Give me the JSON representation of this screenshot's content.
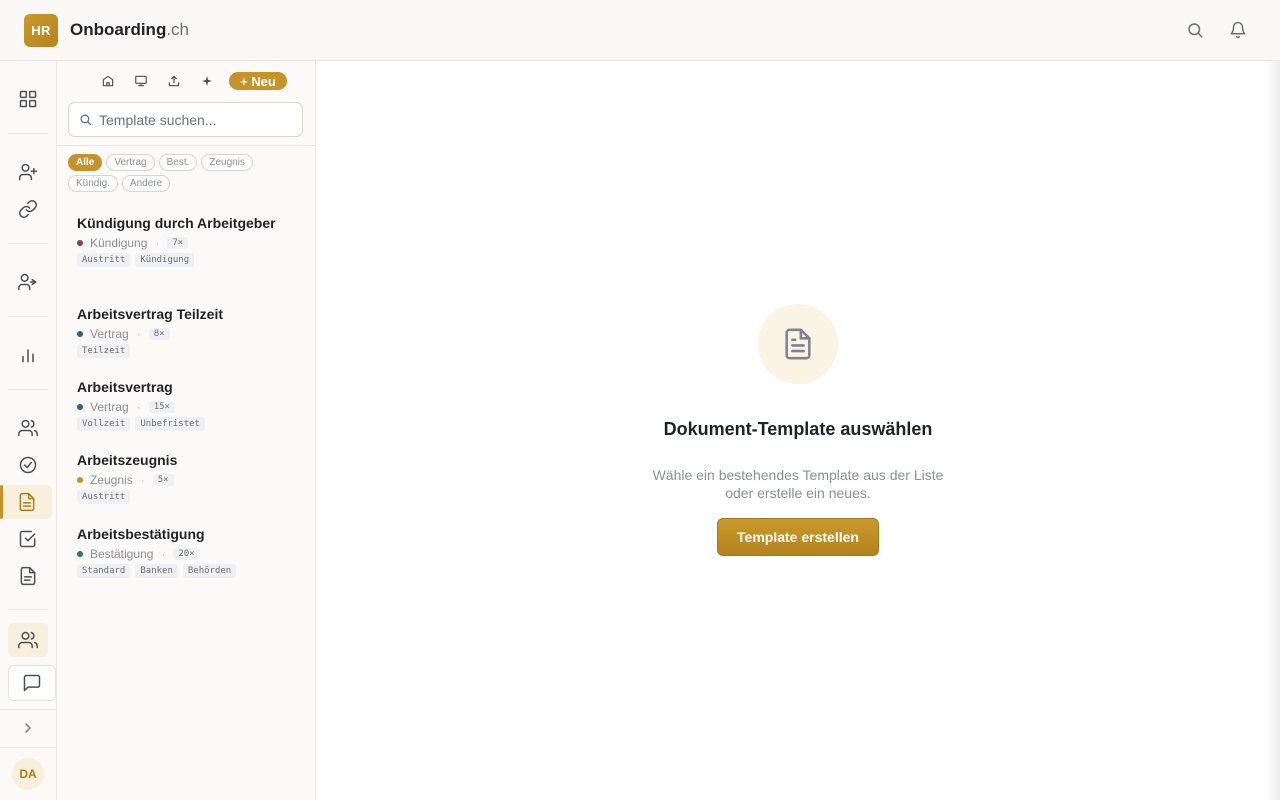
{
  "header": {
    "logo_text": "HR",
    "brand_name": "Onboarding",
    "brand_suffix": ".ch",
    "icons": [
      "search-icon",
      "bell-icon"
    ]
  },
  "rail": {
    "items": [
      {
        "icon": "grid-icon"
      },
      {
        "icon": "user-plus-icon"
      },
      {
        "icon": "link-icon"
      },
      {
        "icon": "user-arrow-icon"
      },
      {
        "icon": "bar-chart-icon"
      },
      {
        "icon": "users-icon"
      },
      {
        "icon": "check-circle-icon"
      },
      {
        "icon": "document-icon",
        "active": true
      },
      {
        "icon": "check-square-icon"
      },
      {
        "icon": "file-icon"
      },
      {
        "icon": "users-icon"
      },
      {
        "icon": "message-icon"
      },
      {
        "icon": "chevron-right-icon"
      }
    ],
    "avatar": "DA"
  },
  "panel": {
    "toolbar_icons": [
      "home-icon",
      "monitor-icon",
      "upload-icon",
      "sparkle-icon"
    ],
    "new_label": "+ Neu",
    "search_placeholder": "Template suchen...",
    "filters": [
      {
        "label": "Alle",
        "active": true
      },
      {
        "label": "Vertrag"
      },
      {
        "label": "Best."
      },
      {
        "label": "Zeugnis"
      },
      {
        "label": "Kündig."
      },
      {
        "label": "Andere"
      }
    ],
    "templates": [
      {
        "title": "Kündigung durch Arbeitgeber",
        "category": "Kündigung",
        "category_color": "#9b3b3b",
        "count": "7×",
        "tags": [
          "Austritt",
          "Kündigung"
        ]
      },
      {
        "title": "Arbeitsvertrag Teilzeit",
        "category": "Vertrag",
        "category_color": "#2f5f86",
        "count": "8×",
        "tags": [
          "Teilzeit"
        ]
      },
      {
        "title": "Arbeitsvertrag",
        "category": "Vertrag",
        "category_color": "#2f5f86",
        "count": "15×",
        "tags": [
          "Vollzeit",
          "Unbefristet"
        ]
      },
      {
        "title": "Arbeitszeugnis",
        "category": "Zeugnis",
        "category_color": "#c5932a",
        "count": "5×",
        "tags": [
          "Austritt"
        ]
      },
      {
        "title": "Arbeitsbestätigung",
        "category": "Bestätigung",
        "category_color": "#2e7d4f",
        "count": "20×",
        "tags": [
          "Standard",
          "Banken",
          "Behörden"
        ]
      }
    ]
  },
  "main": {
    "empty_icon": "document-icon",
    "empty_title": "Dokument-Template auswählen",
    "empty_line1": "Wähle ein bestehendes Template aus der Liste",
    "empty_line2": "oder erstelle ein neues.",
    "create_button": "Template erstellen"
  },
  "colors": {
    "accent": "#c5932a",
    "accent_light": "#f8f0dd"
  }
}
